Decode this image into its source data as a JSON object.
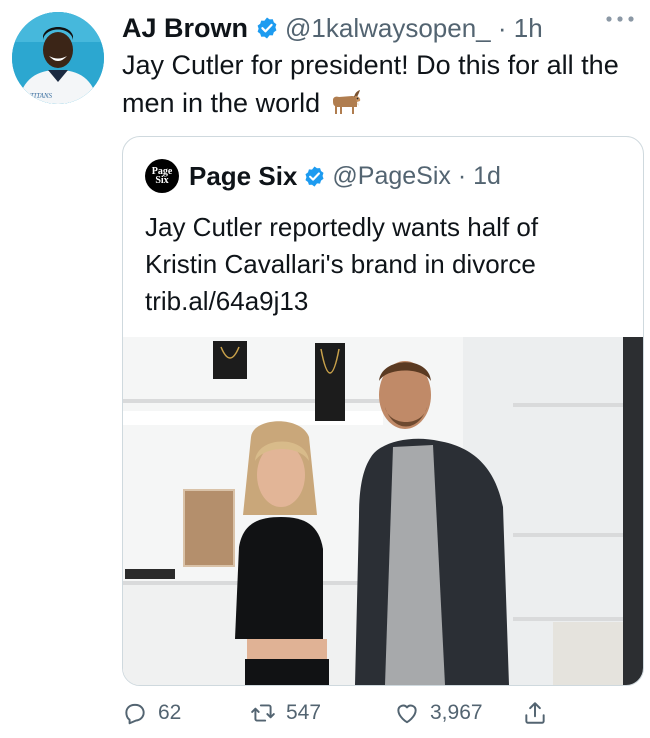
{
  "author": {
    "name": "AJ Brown",
    "handle": "@1kalwaysopen_",
    "time": "1h",
    "jersey_text": "TITANS"
  },
  "tweet": {
    "text_before_emoji": "Jay Cutler for president! Do this for all the men in the world",
    "emoji": "goat-emoji"
  },
  "quoted": {
    "logo_line1": "Page",
    "logo_line2": "Six",
    "name": "Page Six",
    "handle": "@PageSix",
    "time": "1d",
    "text": "Jay Cutler reportedly wants half of Kristin Cavallari's brand in divorce",
    "link": "trib.al/64a9j13"
  },
  "actions": {
    "replies": "62",
    "retweets": "547",
    "likes": "3,967"
  },
  "colors": {
    "verified": "#1d9bf0",
    "secondary_text": "#536471",
    "border": "#cfd9de"
  }
}
